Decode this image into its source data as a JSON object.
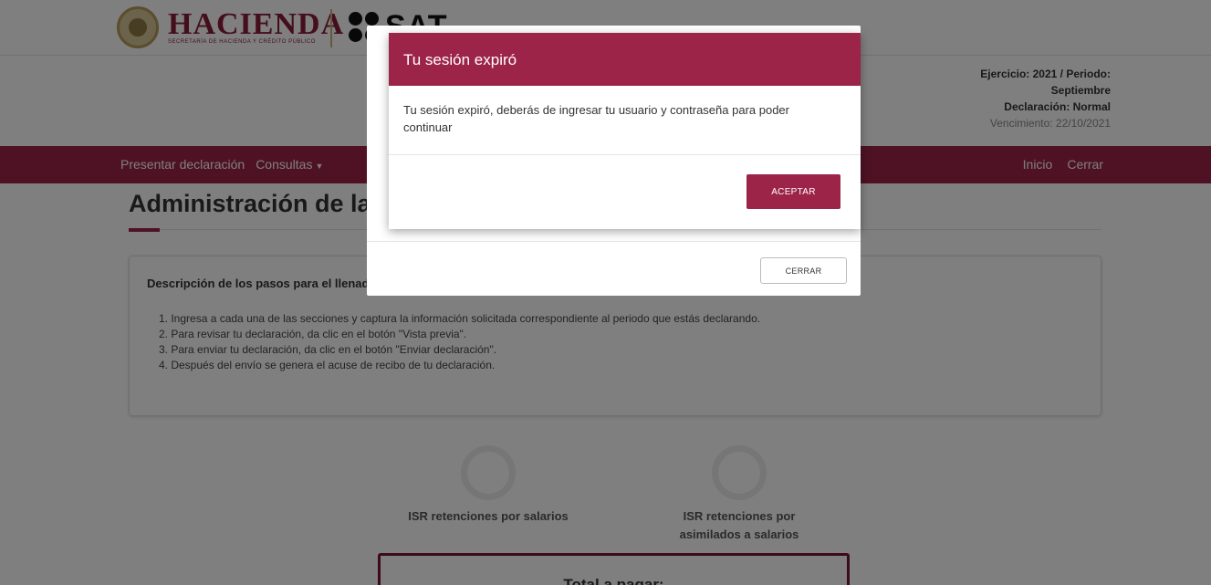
{
  "header": {
    "hacienda_title": "HACIENDA",
    "hacienda_subtitle": "SECRETARÍA DE HACIENDA Y CRÉDITO PÚBLICO",
    "sat_logo": "SAT"
  },
  "period_info": {
    "line1": "Ejercicio: 2021 / Periodo:",
    "line2": "Septiembre",
    "line3": "Declaración: Normal",
    "line4": "Vencimiento: 22/10/2021"
  },
  "nav": {
    "presentar": "Presentar declaración",
    "consultas": "Consultas",
    "inicio": "Inicio",
    "cerrar": "Cerrar"
  },
  "page": {
    "title": "Administración de la declaración"
  },
  "steps": {
    "title": "Descripción de los pasos para el llenado de la declaración",
    "items": [
      "1. Ingresa a cada una de las secciones y captura la información solicitada correspondiente al periodo que estás declarando.",
      "2. Para revisar tu declaración, da clic en el botón \"Vista previa\".",
      "3. Para enviar tu declaración, da clic en el botón \"Enviar declaración\".",
      "4. Después del envío se genera el acuse de recibo de tu declaración."
    ]
  },
  "sections": [
    {
      "label": "ISR retenciones por salarios"
    },
    {
      "label": "ISR retenciones por asimilados a salarios"
    }
  ],
  "total": {
    "label": "Total a pagar:"
  },
  "outer_modal": {
    "close_label": "CERRAR"
  },
  "session_modal": {
    "title": "Tu sesión expiró",
    "message": "Tu sesión expiró, deberás de ingresar tu usuario y contraseña para poder continuar",
    "accept_label": "ACEPTAR"
  },
  "colors": {
    "brand": "#9d2449",
    "brand_dark": "#7a1536"
  }
}
